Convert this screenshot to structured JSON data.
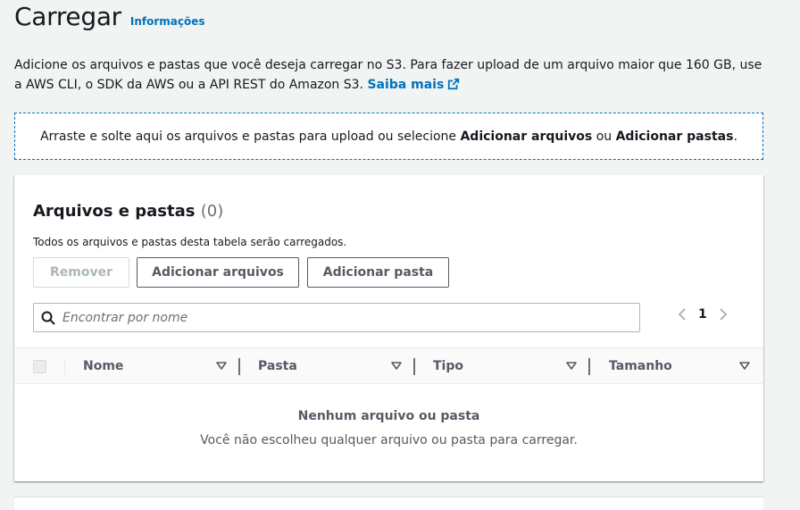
{
  "header": {
    "title": "Carregar",
    "info_link": "Informações"
  },
  "intro": {
    "text": "Adicione os arquivos e pastas que você deseja carregar no S3. Para fazer upload de um arquivo maior que 160 GB, use a AWS CLI, o SDK da AWS ou a API REST do Amazon S3. ",
    "learn_more": "Saiba mais"
  },
  "dropzone": {
    "prefix": "Arraste e solte aqui os arquivos e pastas para upload ou selecione ",
    "add_files": "Adicionar arquivos",
    "middle": " ou ",
    "add_folders": "Adicionar pastas",
    "suffix": "."
  },
  "files_panel": {
    "title": "Arquivos e pastas",
    "count": "(0)",
    "description": "Todos os arquivos e pastas desta tabela serão carregados.",
    "buttons": {
      "remove": "Remover",
      "add_files": "Adicionar arquivos",
      "add_folder": "Adicionar pasta"
    },
    "search": {
      "placeholder": "Encontrar por nome",
      "value": ""
    },
    "pagination": {
      "current_page": "1"
    },
    "columns": [
      "Nome",
      "Pasta",
      "Tipo",
      "Tamanho"
    ],
    "empty": {
      "title": "Nenhum arquivo ou pasta",
      "description": "Você não escolheu qualquer arquivo ou pasta para carregar."
    }
  },
  "icons": {
    "external": "external-link-icon",
    "search": "search-icon",
    "prev": "chevron-left-icon",
    "next": "chevron-right-icon",
    "sort": "caret-down-icon"
  },
  "colors": {
    "link": "#0073bb",
    "background": "#f2f3f3",
    "text": "#16191f",
    "secondary_text": "#545b64"
  }
}
